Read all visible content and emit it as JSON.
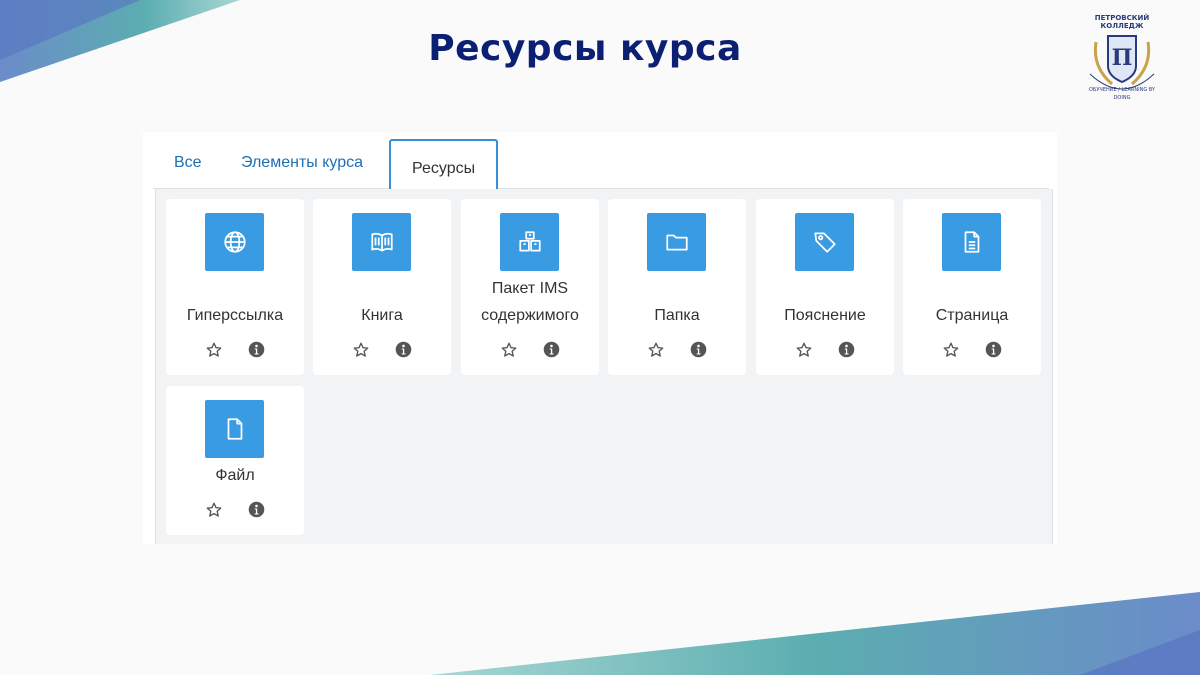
{
  "slide": {
    "title": "Ресурсы курса"
  },
  "logo": {
    "line1": "ПЕТРОВСКИЙ",
    "line2": "КОЛЛЕДЖ",
    "motto": "ОБУЧЕНИЕ / LEARNING BY DOING"
  },
  "chooser": {
    "tabs": [
      {
        "label": "Все",
        "active": false
      },
      {
        "label": "Элементы курса",
        "active": false
      },
      {
        "label": "Ресурсы",
        "active": true
      }
    ],
    "items": [
      {
        "label": "Гиперссылка",
        "icon": "globe-icon"
      },
      {
        "label": "Книга",
        "icon": "book-icon"
      },
      {
        "label": "Пакет IMS содержимого",
        "label_lines": [
          "Пакет IMS",
          "содержимого"
        ],
        "icon": "package-icon"
      },
      {
        "label": "Папка",
        "icon": "folder-icon"
      },
      {
        "label": "Пояснение",
        "icon": "tag-icon"
      },
      {
        "label": "Страница",
        "icon": "page-icon"
      },
      {
        "label": "Файл",
        "icon": "file-icon"
      }
    ]
  },
  "colors": {
    "title": "#0b1f73",
    "accent": "#399be2",
    "tab_link": "#1f6fb5"
  }
}
